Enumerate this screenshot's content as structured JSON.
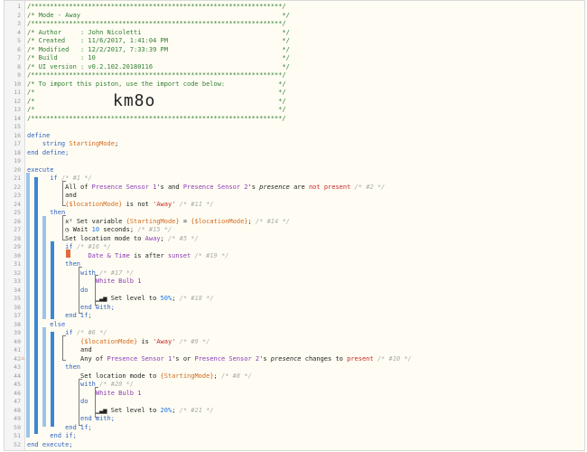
{
  "header": {
    "border_line": "/******************************************************************/",
    "title_line": "/* Mode - Away                                                     */",
    "author": "/* Author     : John Nicoletti                                     */",
    "created": "/* Created    : 11/6/2017, 1:41:04 PM                              */",
    "modified": "/* Modified   : 12/2/2017, 7:33:39 PM                              */",
    "build": "/* Build      : 10                                                 */",
    "ui_version": "/* UI version : v0.2.102.20180116                                  */",
    "import_line": "/* To import this piston, use the import code below:              */",
    "empty_line": "/*                                                                */",
    "import_code": "km8o"
  },
  "line_numbers": [
    "1",
    "2",
    "3",
    "4",
    "5",
    "6",
    "7",
    "8",
    "9",
    "10",
    "11",
    "12",
    "13",
    "14",
    "15",
    "16",
    "17",
    "18",
    "19",
    "20",
    "21",
    "22",
    "23",
    "24",
    "25",
    "26",
    "27",
    "28",
    "29",
    "30",
    "31",
    "32",
    "33",
    "34",
    "35",
    "36",
    "37",
    "38",
    "39",
    "40",
    "41",
    "42",
    "43",
    "44",
    "45",
    "46",
    "47",
    "48",
    "49",
    "50",
    "51",
    "52"
  ],
  "code": {
    "define": "define",
    "string_kw": "string",
    "starting_mode": "StartingMode",
    "semicolon": ";",
    "end_define": "end define;",
    "execute": "execute",
    "if": "if",
    "c1": "/* #1 */",
    "all_of": "All of",
    "presence1": "Presence Sensor 1",
    "s_and": "'s and",
    "presence2": "Presence Sensor 2",
    "s_presence": "'s",
    "presence_word": "presence",
    "are": "are",
    "not_present": "not present",
    "c2": "/* #2 */",
    "and": "and",
    "location_mode": "{$locationMode}",
    "is_not": "is not",
    "away_str": "'Away'",
    "c11": "/* #11 */",
    "then": "then",
    "set_variable": "Set variable",
    "starting_mode_brace": "{StartingMode}",
    "equals": "=",
    "c14": "/* #14 */",
    "wait": "Wait",
    "ten": "10",
    "seconds": "seconds;",
    "c15": "/* #15 */",
    "set_location_mode_to": "Set location mode to",
    "away_link": "Away",
    "c5": "/* #5 */",
    "c16": "/* #16 */",
    "date_time": "Date & Time",
    "is_after": "is after",
    "sunset": "sunset",
    "c19": "/* #19 */",
    "with": "with",
    "c17": "/* #17 */",
    "white_bulb": "White Bulb 1",
    "do": "do",
    "set_level_to": "Set level to",
    "fifty": "50%",
    "c18": "/* #18 */",
    "end_with": "end with;",
    "end_if": "end if;",
    "else": "else",
    "c6": "/* #6 */",
    "is": "is",
    "c9": "/* #9 */",
    "any_of": "Any of",
    "s_or": "'s or",
    "changes_to": "changes to",
    "present": "present",
    "c10": "/* #10 */",
    "c8": "/* #8 */",
    "c20": "/* #20 */",
    "twenty": "20%",
    "c21": "/* #21 */",
    "end_execute": "end execute;"
  },
  "icons": [
    "variable-icon",
    "clock-icon",
    "signal-bars-icon",
    "warning-icon"
  ],
  "colors": {
    "background": "#fffdf3",
    "comment": "#2e7d32",
    "keyword": "#3060c0",
    "variable": "#d2691e",
    "device": "#8b3ab8",
    "string": "#c62828",
    "number": "#1a73e8",
    "block_bar": "#3a86d6",
    "condition_marker": "#e06a3a"
  }
}
